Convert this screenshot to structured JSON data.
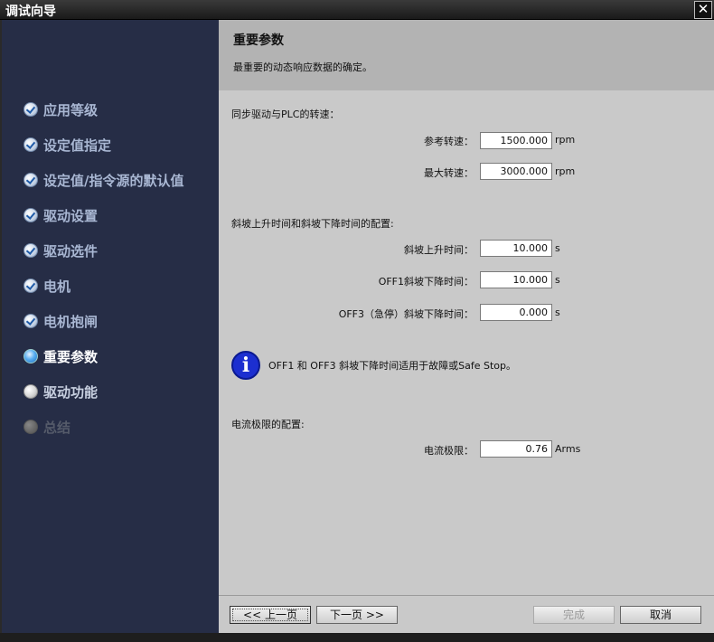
{
  "window": {
    "title": "调试向导",
    "close_label": "✕"
  },
  "sidebar": {
    "steps": [
      {
        "label": "应用等级",
        "state": "done"
      },
      {
        "label": "设定值指定",
        "state": "done"
      },
      {
        "label": "设定值/指令源的默认值",
        "state": "done"
      },
      {
        "label": "驱动设置",
        "state": "done"
      },
      {
        "label": "驱动选件",
        "state": "done"
      },
      {
        "label": "电机",
        "state": "done"
      },
      {
        "label": "电机抱闸",
        "state": "done"
      },
      {
        "label": "重要参数",
        "state": "current"
      },
      {
        "label": "驱动功能",
        "state": "pending"
      },
      {
        "label": "总结",
        "state": "disabled"
      }
    ]
  },
  "header": {
    "title": "重要参数",
    "subtitle": "最重要的动态响应数据的确定。"
  },
  "speed": {
    "section_label": "同步驱动与PLC的转速：",
    "ref_label": "参考转速：",
    "ref_value": "1500.000",
    "ref_unit": "rpm",
    "max_label": "最大转速：",
    "max_value": "3000.000",
    "max_unit": "rpm"
  },
  "ramp": {
    "section_label": "斜坡上升时间和斜坡下降时间的配置:",
    "up_label": "斜坡上升时间：",
    "up_value": "10.000",
    "up_unit": "s",
    "off1_label": "OFF1斜坡下降时间：",
    "off1_value": "10.000",
    "off1_unit": "s",
    "off3_label": "OFF3（急停）斜坡下降时间：",
    "off3_value": "0.000",
    "off3_unit": "s"
  },
  "info": {
    "icon": "info-icon",
    "icon_glyph": "i",
    "text": "OFF1 和 OFF3 斜坡下降时间适用于故障或Safe Stop。"
  },
  "current": {
    "section_label": "电流极限的配置:",
    "limit_label": "电流极限：",
    "limit_value": "0.76",
    "limit_unit": "Arms"
  },
  "footer": {
    "prev_label": "<< 上一页",
    "next_label": "下一页 >>",
    "finish_label": "完成",
    "cancel_label": "取消"
  },
  "colors": {
    "sidebar_bg": "#262d46",
    "header_bg": "#b3b3b3",
    "panel_bg": "#c9c9c9",
    "info_blue": "#1c2fd0"
  }
}
